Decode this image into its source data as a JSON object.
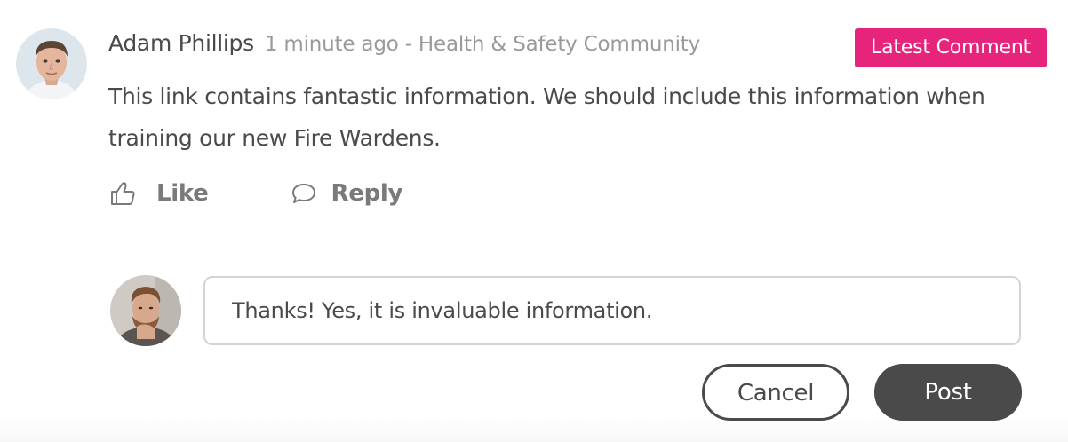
{
  "comment": {
    "author_name": "Adam Phillips",
    "meta": "1 minute ago - Health & Safety Community",
    "badge": "Latest Comment",
    "body": "This link contains fantastic information. We should include this information when training our new Fire Wardens.",
    "actions": {
      "like_label": "Like",
      "reply_label": "Reply"
    }
  },
  "reply_form": {
    "input_value": "Thanks! Yes, it is invaluable information.",
    "cancel_label": "Cancel",
    "post_label": "Post"
  },
  "colors": {
    "badge_bg": "#e6247b",
    "text": "#4a4a4a",
    "muted_text": "#9a9a9a",
    "post_button_bg": "#4a4a4a"
  },
  "icons": [
    "thumbs-up-icon",
    "speech-bubble-icon"
  ]
}
